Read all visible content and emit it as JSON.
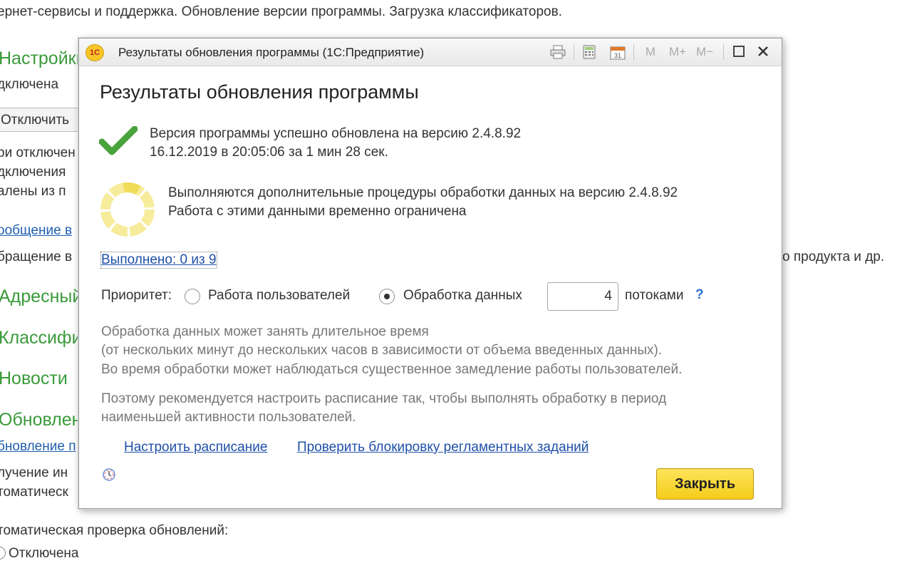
{
  "background": {
    "top_text": "ернет-сервисы и поддержка. Обновление версии программы. Загрузка классификаторов.",
    "settings_heading": "Настройки",
    "disabled_text": "дключена",
    "disable_button": "Отключить",
    "line1": "ри отключен",
    "line2": "дключения",
    "line3": "алены из п",
    "message_link": "ообщение в",
    "appeal_text": "бращение в",
    "appeal_right": "о продукта и др.",
    "address_heading": "Адресный",
    "classifiers_heading": "Классифи",
    "news_heading": "Новости",
    "updates_heading": "Обновлен",
    "update_link": "бновление п",
    "receive_text": "лучение ин",
    "auto_text": "томатическ",
    "auto_check_label": "томатическая проверка обновлений:",
    "auto_check_value": "Отключена"
  },
  "dialog": {
    "window_title": "Результаты обновления программы  (1С:Предприятие)",
    "logo_text": "1С",
    "toolbar": {
      "m_label": "M",
      "mplus_label": "M+",
      "mminus_label": "M−",
      "calendar_day": "31"
    },
    "heading": "Результаты обновления программы",
    "success_line1": "Версия программы успешно обновлена на версию 2.4.8.92",
    "success_line2": "16.12.2019 в 20:05:06 за 1 мин 28 сек.",
    "processing_line1": "Выполняются дополнительные процедуры обработки данных на версию 2.4.8.92",
    "processing_line2": "Работа с этими данными временно ограничена",
    "progress_link": "Выполнено: 0 из 9",
    "priority_label": "Приоритет:",
    "option_users": "Работа пользователей",
    "option_data": "Обработка данных",
    "threads_value": "4",
    "threads_label": "потоками",
    "help_label": "?",
    "note1_line1": "Обработка данных может занять длительное время",
    "note1_line2": "(от нескольких минут до нескольких часов в зависимости от объема введенных данных).",
    "note1_line3": "Во время обработки может наблюдаться существенное замедление работы пользователей.",
    "note2_line1": "Поэтому рекомендуется настроить расписание так, чтобы выполнять обработку в период",
    "note2_line2": "наименьшей активности пользователей.",
    "schedule_link": "Настроить расписание",
    "check_lock_link": "Проверить блокировку регламентных заданий",
    "close_button": "Закрыть"
  },
  "colors": {
    "success_check": "#4aa33c",
    "spinner": "#f5e67a",
    "link": "#1f4fa8",
    "close_button": "#f8d52a",
    "green_heading": "#3a9a3a"
  }
}
